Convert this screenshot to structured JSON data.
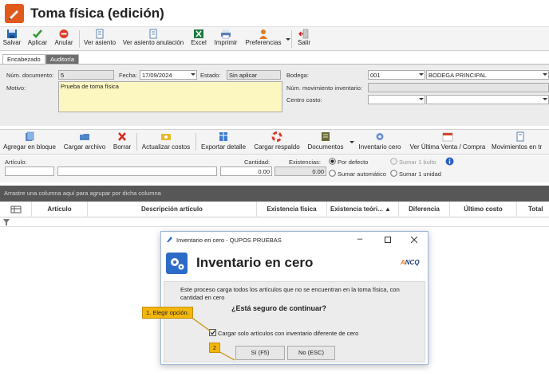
{
  "window": {
    "title": "Toma física (edición)"
  },
  "toolbar": {
    "save": "Salvar",
    "apply": "Aplicar",
    "void": "Anular",
    "view_entry": "Ver asiento",
    "view_void_entry": "Ver asiento anulación",
    "excel": "Excel",
    "print": "Imprimir",
    "preferences": "Preferencias",
    "exit": "Salir"
  },
  "tabs": {
    "header": "Encabezado",
    "audit": "Auditoría"
  },
  "header": {
    "doc_num_label": "Núm. documento:",
    "doc_num": "5",
    "date_label": "Fecha:",
    "date": "17/09/2024",
    "status_label": "Estado:",
    "status": "Sin aplicar",
    "reason_label": "Motivo:",
    "reason": "Prueba de toma física",
    "warehouse_label": "Bodega:",
    "warehouse_code": "001",
    "warehouse_name": "BODEGA PRINCIPAL",
    "movement_label": "Núm. movimiento inventario:",
    "cost_center_label": "Centro costo:"
  },
  "toolbar2": {
    "add_batch": "Agregar en bloque",
    "load_file": "Cargar archivo",
    "delete": "Borrar",
    "update_costs": "Actualizar costos",
    "export_detail": "Exportar detalle",
    "load_backup": "Cargar respaldo",
    "documents": "Documentos",
    "zero_inventory": "Inventario cero",
    "last_sale": "Ver Última Venta / Compra",
    "movements": "Movimientos en tr"
  },
  "entry": {
    "article_label": "Artículo:",
    "quantity_label": "Cantidad:",
    "quantity": "0.00",
    "stock_label": "Existencias:",
    "stock": "0.00",
    "opt_default": "Por defecto",
    "opt_add_one_pack": "Sumar 1 bulto",
    "opt_auto_add": "Sumar automático",
    "opt_add_one_unit": "Sumar 1 unidad"
  },
  "grid": {
    "group_hint": "Arrastre una columna aquí para agrupar por dicha columna",
    "columns": [
      "Artículo",
      "Descripción artículo",
      "Existencia física",
      "Existencia teóri...",
      "Diferencia",
      "Último costo",
      "Total"
    ]
  },
  "dialog": {
    "title": "Inventario en cero - QUPOS PRUEBAS",
    "heading": "Inventario en cero",
    "logo_text": "NCQ",
    "message": "Este proceso carga todos los artículos que no se encuentran en la toma física, con cantidad en cero",
    "question": "¿Está seguro de continuar?",
    "checkbox_label": "Cargar solo artículos con inventario diferente de cero",
    "checkbox_checked": true,
    "yes_button": "Sí (F5)",
    "no_button": "No (ESC)"
  },
  "callouts": {
    "step1": "1. Elegir opción.",
    "step2": "2"
  }
}
